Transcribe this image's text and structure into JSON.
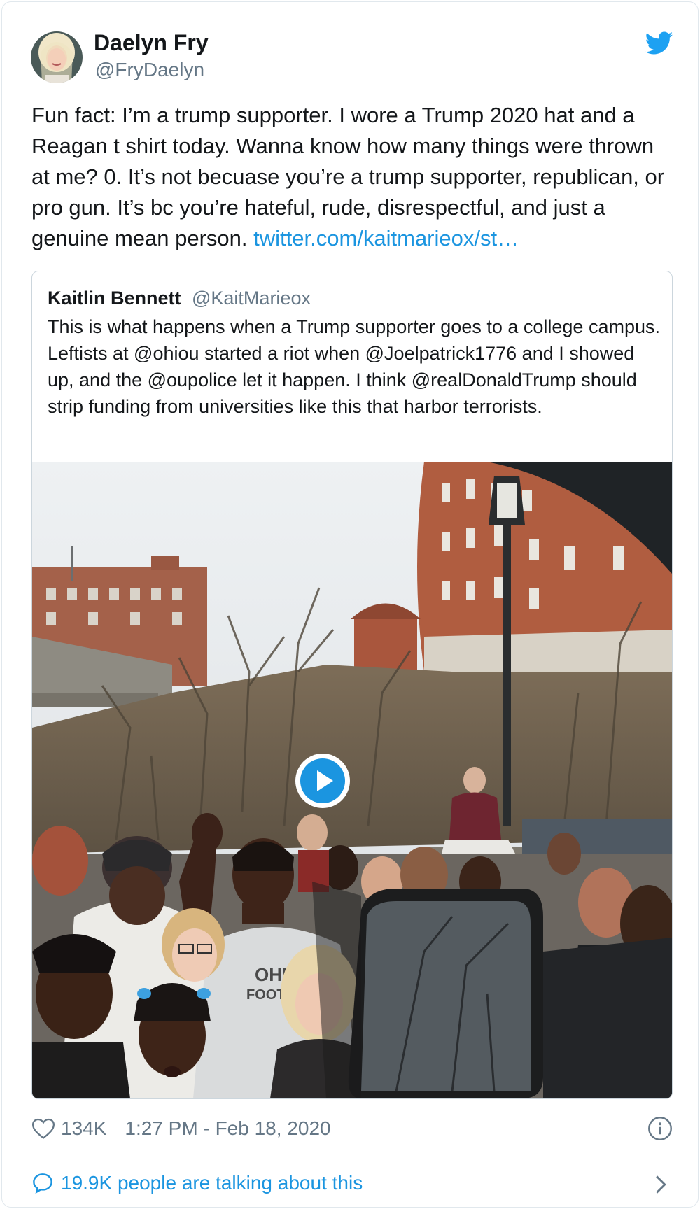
{
  "author": {
    "name": "Daelyn Fry",
    "handle": "@FryDaelyn"
  },
  "tweet": {
    "text": "Fun fact: I’m a trump supporter. I wore a Trump 2020 hat and a Reagan t shirt today. Wanna know how many things were thrown at me?  0. It’s not becuase you’re a trump supporter, republican, or pro gun. It’s bc you’re hateful, rude, disrespectful, and just a genuine mean person. ",
    "link": "twitter.com/kaitmarieox/st…"
  },
  "quoted": {
    "name": "Kaitlin Bennett",
    "handle": "@KaitMarieox",
    "text": "This is what happens when a Trump supporter goes to a college campus. Leftists at @ohiou started a riot when @Joelpatrick1776 and I showed up, and the @oupolice let it happen. I think @realDonaldTrump should strip funding from universities like this that harbor terrorists.",
    "shirt_text_1": "OHIO",
    "shirt_text_2": "FOOTBALL"
  },
  "footer": {
    "likes": "134K",
    "timestamp": "1:27 PM - Feb 18, 2020",
    "talking": "19.9K people are talking about this"
  },
  "icons": [
    "twitter-bird-icon",
    "heart-icon",
    "info-icon",
    "speech-bubble-icon",
    "chevron-right-icon",
    "play-icon"
  ],
  "colors": {
    "link": "#1b95e0",
    "secondary_text": "#657786",
    "border": "#e1e8ed",
    "play_button": "#1b95e0"
  }
}
